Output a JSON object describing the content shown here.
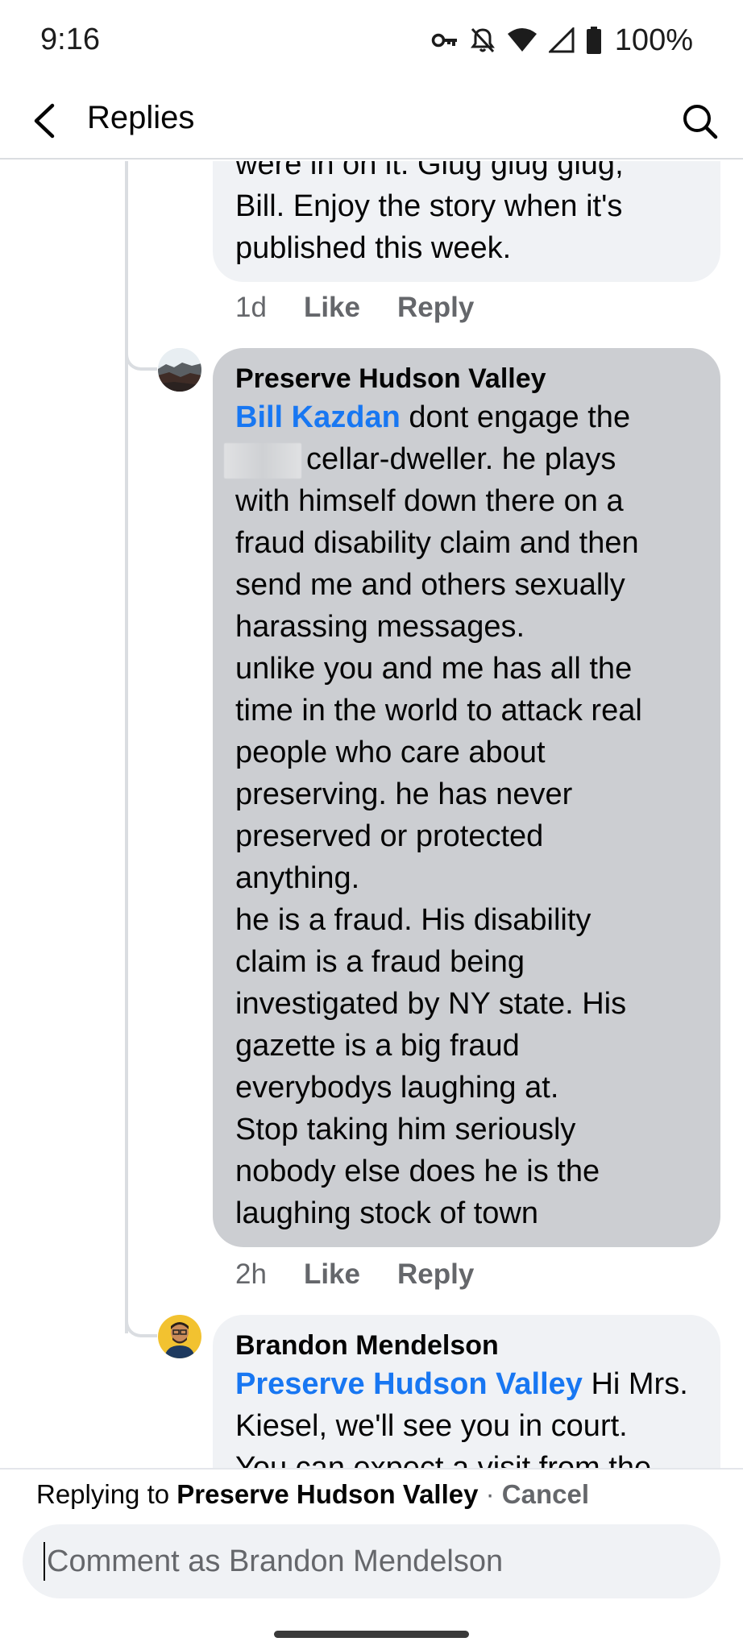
{
  "status_bar": {
    "time": "9:16",
    "battery": "100%",
    "icons": [
      "vpn-key-icon",
      "mute-icon",
      "wifi-icon",
      "signal-icon",
      "battery-icon"
    ]
  },
  "header": {
    "back_icon": "back-arrow-icon",
    "title": "Replies",
    "search_icon": "search-icon"
  },
  "comments": [
    {
      "text": "were in on it. Glug glug glug,\nBill. Enjoy the story when it's\npublished this week.",
      "time": "1d",
      "like": "Like",
      "reply": "Reply"
    },
    {
      "author": "Preserve Hudson Valley",
      "mention": "Bill Kazdan",
      "text_a": " dont engage the",
      "text_b": "cellar-dweller. he plays\nwith himself down there on a\nfraud disability claim and then\nsend me and others sexually\nharassing messages.\nunlike you and me has all the\ntime in the world to attack real\npeople who care about\npreserving. he has never\npreserved or protected\nanything.\nhe is a fraud. His disability\nclaim is a fraud being\ninvestigated by NY state. His\ngazette is a big fraud\neverybodys laughing at.\nStop taking him seriously\nnobody else does he is the\nlaughing stock of town",
      "time": "2h",
      "like": "Like",
      "reply": "Reply"
    },
    {
      "author": "Brandon Mendelson",
      "mention": "Preserve Hudson Valley",
      "text_a": " Hi Mrs.",
      "text_b": "Kiesel, we'll see you in court.\nYou can expect a visit from the"
    }
  ],
  "composer": {
    "replying_prefix": "Replying to ",
    "replying_name": "Preserve Hudson Valley",
    "separator": " · ",
    "cancel": "Cancel",
    "placeholder": "Comment as Brandon Mendelson"
  },
  "colors": {
    "mention": "#1877f2",
    "bubble_light": "#f0f2f5",
    "bubble_highlight": "#ccced2",
    "meta": "#65676b"
  }
}
